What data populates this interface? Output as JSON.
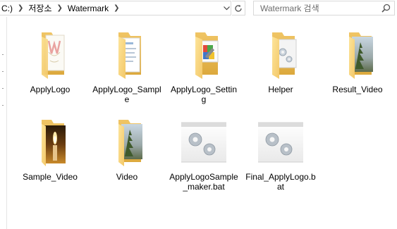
{
  "address": {
    "root_partial": "C:)",
    "crumbs": [
      "저장소",
      "Watermark"
    ]
  },
  "search": {
    "placeholder": "Watermark 검색"
  },
  "items": [
    {
      "name": "ApplyLogo",
      "type": "folder"
    },
    {
      "name": "ApplyLogo_Sample",
      "type": "folder"
    },
    {
      "name": "ApplyLogo_Setting",
      "type": "folder"
    },
    {
      "name": "Helper",
      "type": "folder"
    },
    {
      "name": "Result_Video",
      "type": "folder"
    },
    {
      "name": "Sample_Video",
      "type": "folder"
    },
    {
      "name": "Video",
      "type": "folder"
    },
    {
      "name": "ApplyLogoSample_maker.bat",
      "type": "batch-file"
    },
    {
      "name": "Final_ApplyLogo.bat",
      "type": "batch-file"
    }
  ],
  "colors": {
    "folder_back": "#e8b84a",
    "folder_front": "#f9d77f",
    "selection_border": "#d9d9d9"
  },
  "icons": {
    "refresh": "refresh-icon",
    "search": "search-icon",
    "dropdown": "chevron-down-icon",
    "separator": "chevron-right-icon"
  }
}
